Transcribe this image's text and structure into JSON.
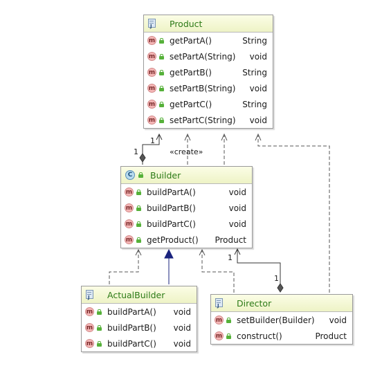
{
  "classes": {
    "product": {
      "name": "Product",
      "methods": [
        {
          "name": "getPartA()",
          "type": "String"
        },
        {
          "name": "setPartA(String)",
          "type": "void"
        },
        {
          "name": "getPartB()",
          "type": "String"
        },
        {
          "name": "setPartB(String)",
          "type": "void"
        },
        {
          "name": "getPartC()",
          "type": "String"
        },
        {
          "name": "setPartC(String)",
          "type": "void"
        }
      ]
    },
    "builder": {
      "name": "Builder",
      "methods": [
        {
          "name": "buildPartA()",
          "type": "void"
        },
        {
          "name": "buildPartB()",
          "type": "void"
        },
        {
          "name": "buildPartC()",
          "type": "void"
        },
        {
          "name": "getProduct()",
          "type": "Product"
        }
      ]
    },
    "actual_builder": {
      "name": "ActualBuilder",
      "methods": [
        {
          "name": "buildPartA()",
          "type": "void"
        },
        {
          "name": "buildPartB()",
          "type": "void"
        },
        {
          "name": "buildPartC()",
          "type": "void"
        }
      ]
    },
    "director": {
      "name": "Director",
      "methods": [
        {
          "name": "setBuilder(Builder)",
          "type": "void"
        },
        {
          "name": "construct()",
          "type": "Product"
        }
      ]
    }
  },
  "method_badge": "m",
  "class_badge": "C",
  "labels": {
    "create": "«create»",
    "mult_builder_product_top": "1",
    "mult_builder_product_bottom": "1",
    "mult_director_builder_top": "1",
    "mult_director_builder_bottom": "1"
  },
  "colors": {
    "title_green": "#2c7a16",
    "header_bg": "#eef3c6",
    "dependency_line": "#555555",
    "inheritance_line": "#1a237e",
    "badge_pink": "#f4b6b6",
    "lock_green": "#56b13a"
  }
}
